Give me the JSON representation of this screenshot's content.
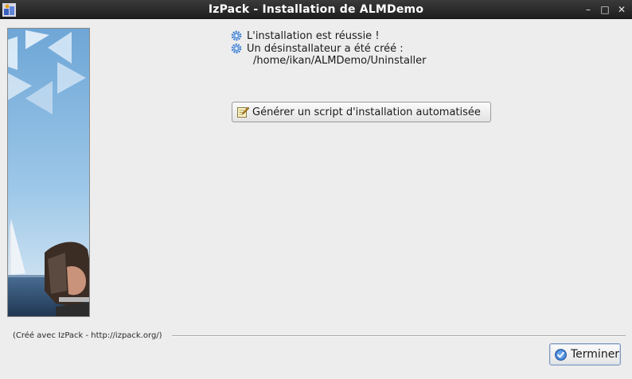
{
  "window": {
    "title": "IzPack - Installation de ALMDemo",
    "controls": {
      "minimize": "–",
      "maximize": "□",
      "close": "✕"
    }
  },
  "content": {
    "messages": [
      "L'installation est réussie !",
      "Un désinstallateur a été créé :"
    ],
    "uninstaller_path": "/home/ikan/ALMDemo/Uninstaller",
    "generate_script_label": "Générer un script d'installation automatisée"
  },
  "footer": {
    "credit": "(Créé avec IzPack - http://izpack.org/)",
    "finish_label": "Terminer"
  },
  "icons": {
    "app": "izpack-app-icon",
    "message_bullet": "gear-icon",
    "generate": "pencil-note-icon",
    "finish": "checkmark-icon"
  },
  "colors": {
    "titlebar": "#2b2b2b",
    "background": "#ededed",
    "sky": "#8fbde0",
    "accent_blue": "#3d7fd1"
  }
}
